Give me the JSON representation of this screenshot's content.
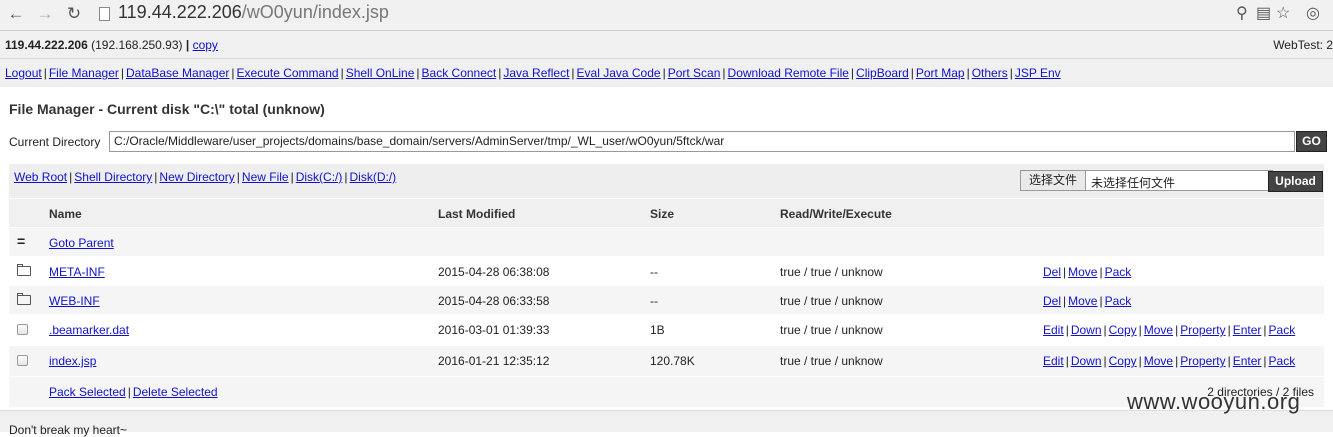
{
  "browser": {
    "url_host": "119.44.222.206",
    "url_path": "/wO0yun/index.jsp"
  },
  "header": {
    "host": "119.44.222.206",
    "ip": "(192.168.250.93)",
    "copy_label": "copy",
    "webtest": "WebTest: 2"
  },
  "menu": [
    "Logout",
    "File Manager",
    "DataBase Manager",
    "Execute Command",
    "Shell OnLine",
    "Back Connect",
    "Java Reflect",
    "Eval Java Code",
    "Port Scan",
    "Download Remote File",
    "ClipBoard",
    "Port Map",
    "Others",
    "JSP Env"
  ],
  "title": "File Manager - Current disk \"C:\\\" total (unknow)",
  "directory": {
    "label": "Current Directory",
    "value": "C:/Oracle/Middleware/user_projects/domains/base_domain/servers/AdminServer/tmp/_WL_user/wO0yun/5ftck/war",
    "go_label": "GO"
  },
  "quick_links": [
    "Web Root",
    "Shell Directory",
    "New Directory",
    "New File",
    "Disk(C:/)",
    "Disk(D:/)"
  ],
  "upload": {
    "choose_label": "选择文件",
    "no_file": "未选择任何文件",
    "upload_label": "Upload"
  },
  "table": {
    "headers": {
      "name": "Name",
      "modified": "Last Modified",
      "size": "Size",
      "rwx": "Read/Write/Execute"
    },
    "parent": {
      "icon": "=",
      "label": "Goto Parent"
    },
    "rows": [
      {
        "name": "META-INF",
        "modified": "2015-04-28 06:38:08",
        "size": "--",
        "rwx": "true / true / unknow",
        "actions": [
          "Del",
          "Move",
          "Pack"
        ]
      },
      {
        "name": "WEB-INF",
        "modified": "2015-04-28 06:33:58",
        "size": "--",
        "rwx": "true / true / unknow",
        "actions": [
          "Del",
          "Move",
          "Pack"
        ]
      },
      {
        "name": ".beamarker.dat",
        "modified": "2016-03-01 01:39:33",
        "size": "1B",
        "rwx": "true / true / unknow",
        "actions": [
          "Edit",
          "Down",
          "Copy",
          "Move",
          "Property",
          "Enter",
          "Pack"
        ]
      },
      {
        "name": "index.jsp",
        "modified": "2016-01-21 12:35:12",
        "size": "120.78K",
        "rwx": "true / true / unknow",
        "actions": [
          "Edit",
          "Down",
          "Copy",
          "Move",
          "Property",
          "Enter",
          "Pack"
        ]
      }
    ],
    "pack_selected": "Pack Selected",
    "delete_selected": "Delete Selected",
    "summary": "2 directories / 2 files"
  },
  "footer": {
    "slogan": "Don't break my heart~",
    "watermark": "www.wooyun.org"
  }
}
